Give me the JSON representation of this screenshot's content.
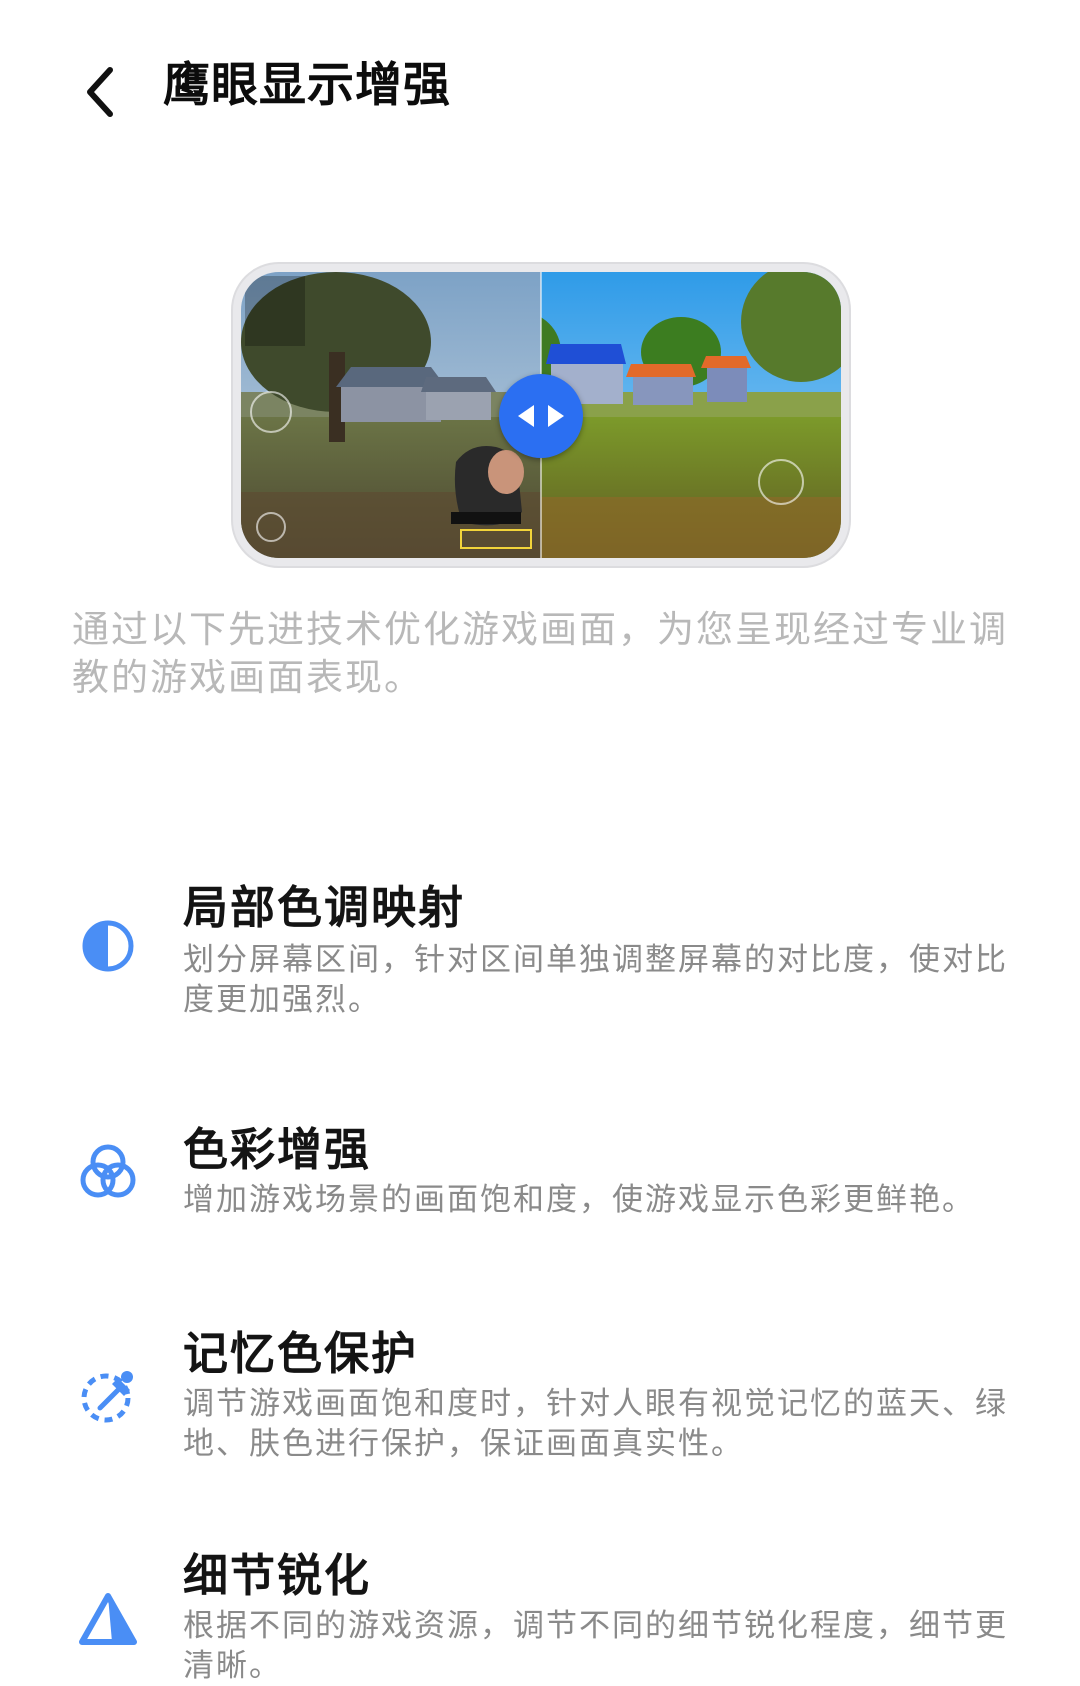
{
  "header": {
    "title": "鹰眼显示增强",
    "back_icon": "chevron-left-icon"
  },
  "preview": {
    "handle_icon": "compare-arrows-icon",
    "accent_color": "#2b6ff2"
  },
  "intro": {
    "text": "通过以下先进技术优化游戏画面，为您呈现经过专业调教的游戏画面表现。"
  },
  "features": [
    {
      "icon": "contrast-half-circle-icon",
      "title": "局部色调映射",
      "description": "划分屏幕区间，针对区间单独调整屏幕的对比度，使对比度更加强烈。"
    },
    {
      "icon": "color-circles-icon",
      "title": "色彩增强",
      "description": "增加游戏场景的画面饱和度，使游戏显示色彩更鲜艳。"
    },
    {
      "icon": "color-picker-icon",
      "title": "记忆色保护",
      "description": "调节游戏画面饱和度时，针对人眼有视觉记忆的蓝天、绿地、肤色进行保护，保证画面真实性。"
    },
    {
      "icon": "sharpen-triangle-icon",
      "title": "细节锐化",
      "description": "根据不同的游戏资源，调节不同的细节锐化程度，细节更清晰。"
    }
  ],
  "colors": {
    "icon_blue": "#4a8ef5",
    "title_text": "#141414",
    "desc_text": "#8a8a8a",
    "intro_text": "#b8b8b8"
  }
}
